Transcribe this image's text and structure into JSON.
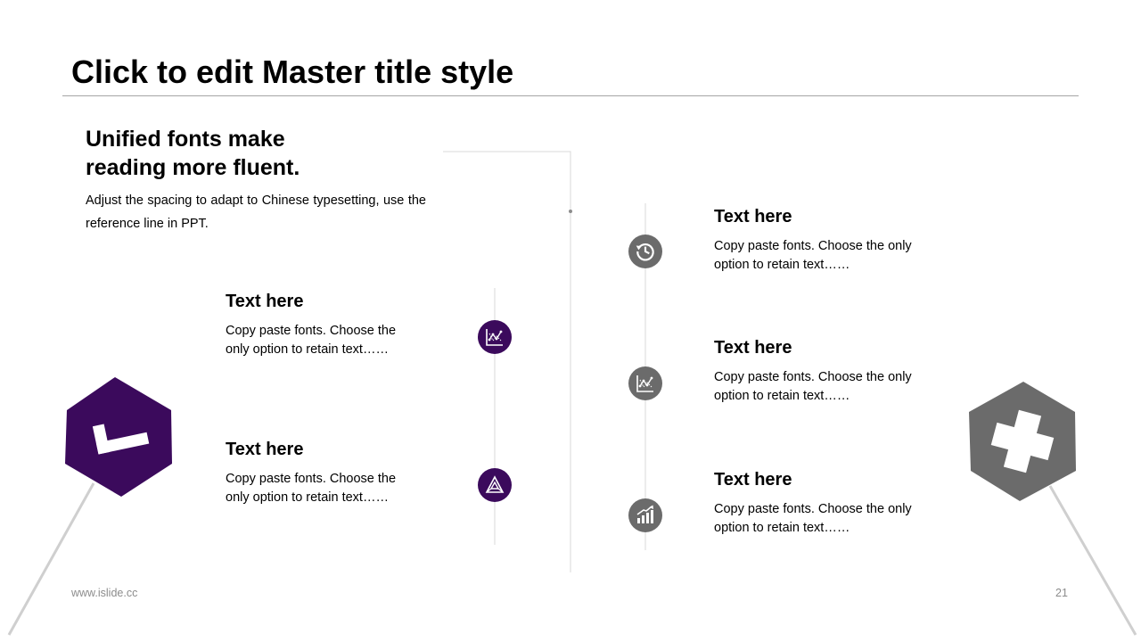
{
  "slide": {
    "title": "Click to edit Master title style",
    "lead_line1": "Unified fonts make",
    "lead_line2": "reading more fluent.",
    "intro": "Adjust the spacing to adapt to Chinese typesetting, use the reference line in PPT."
  },
  "left_items": [
    {
      "heading": "Text here",
      "body_line1": "Copy paste fonts. Choose the",
      "body_line2": "only option to retain text……",
      "icon": "line-chart-icon"
    },
    {
      "heading": "Text here",
      "body_line1": "Copy paste fonts. Choose the",
      "body_line2": "only option to retain text……",
      "icon": "triangle-network-icon"
    }
  ],
  "right_items": [
    {
      "heading": "Text here",
      "body_line1": "Copy paste fonts. Choose the only",
      "body_line2": "option to retain text……",
      "icon": "history-clock-icon"
    },
    {
      "heading": "Text here",
      "body_line1": "Copy paste fonts. Choose the only",
      "body_line2": "option to retain text……",
      "icon": "line-chart-icon"
    },
    {
      "heading": "Text here",
      "body_line1": "Copy paste fonts. Choose the only",
      "body_line2": "option to retain text……",
      "icon": "bar-chart-growth-icon"
    }
  ],
  "decor": {
    "left_hexagon_icon": "check-mark-icon",
    "right_hexagon_icon": "plus-cross-icon"
  },
  "colors": {
    "accent_purple": "#3b0a5c",
    "accent_gray": "#6b6b6b",
    "rule_gray": "#a6a6a6"
  },
  "footer": {
    "website": "www.islide.cc",
    "page_number": "21"
  }
}
